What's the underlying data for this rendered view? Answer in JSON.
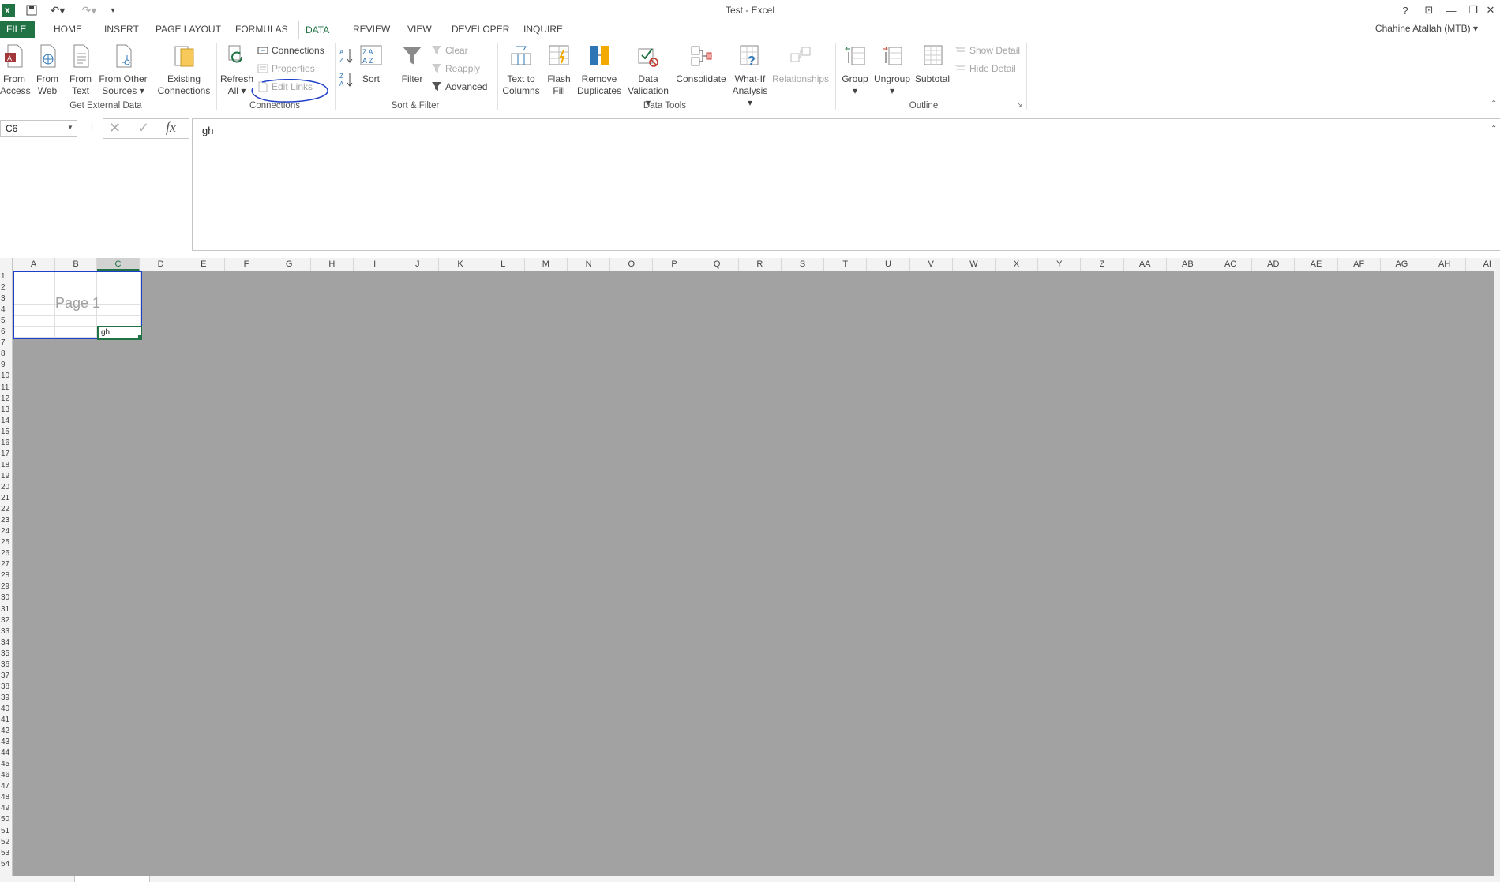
{
  "window": {
    "title": "Test - Excel",
    "user": "Chahine Atallah (MTB)",
    "help": "?"
  },
  "tabs": [
    "FILE",
    "HOME",
    "INSERT",
    "PAGE LAYOUT",
    "FORMULAS",
    "DATA",
    "REVIEW",
    "VIEW",
    "DEVELOPER",
    "INQUIRE"
  ],
  "active_tab": "DATA",
  "ribbon": {
    "get_external_data": {
      "label": "Get External Data",
      "from_access": [
        "From",
        "Access"
      ],
      "from_web": [
        "From",
        "Web"
      ],
      "from_text": [
        "From",
        "Text"
      ],
      "from_other": [
        "From Other",
        "Sources"
      ],
      "existing": [
        "Existing",
        "Connections"
      ]
    },
    "connections": {
      "label": "Connections",
      "refresh": [
        "Refresh",
        "All"
      ],
      "connections": "Connections",
      "properties": "Properties",
      "edit_links": "Edit Links"
    },
    "sort_filter": {
      "label": "Sort & Filter",
      "sort": "Sort",
      "filter": "Filter",
      "clear": "Clear",
      "reapply": "Reapply",
      "advanced": "Advanced"
    },
    "data_tools": {
      "label": "Data Tools",
      "text_to_columns": [
        "Text to",
        "Columns"
      ],
      "flash_fill": [
        "Flash",
        "Fill"
      ],
      "remove_duplicates": [
        "Remove",
        "Duplicates"
      ],
      "data_validation": [
        "Data",
        "Validation"
      ],
      "consolidate": "Consolidate",
      "what_if": [
        "What-If",
        "Analysis"
      ],
      "relationships": "Relationships"
    },
    "outline": {
      "label": "Outline",
      "group": "Group",
      "ungroup": "Ungroup",
      "subtotal": "Subtotal",
      "show_detail": "Show Detail",
      "hide_detail": "Hide Detail"
    }
  },
  "formula_bar": {
    "name_box": "C6",
    "fx": "fx",
    "formula": "gh"
  },
  "grid": {
    "columns": [
      "A",
      "B",
      "C",
      "D",
      "E",
      "F",
      "G",
      "H",
      "I",
      "J",
      "K",
      "L",
      "M",
      "N",
      "O",
      "P",
      "Q",
      "R",
      "S",
      "T",
      "U",
      "V",
      "W",
      "X",
      "Y",
      "Z",
      "AA",
      "AB",
      "AC",
      "AD",
      "AE",
      "AF",
      "AG",
      "AH",
      "AI"
    ],
    "selected_column": "C",
    "rows": 54,
    "watermark": "Page 1",
    "active_cell_value": "gh"
  },
  "colors": {
    "excel_green": "#217346",
    "annotation_blue": "#1e3fc9",
    "page_break_gray": "#a2a2a2"
  }
}
